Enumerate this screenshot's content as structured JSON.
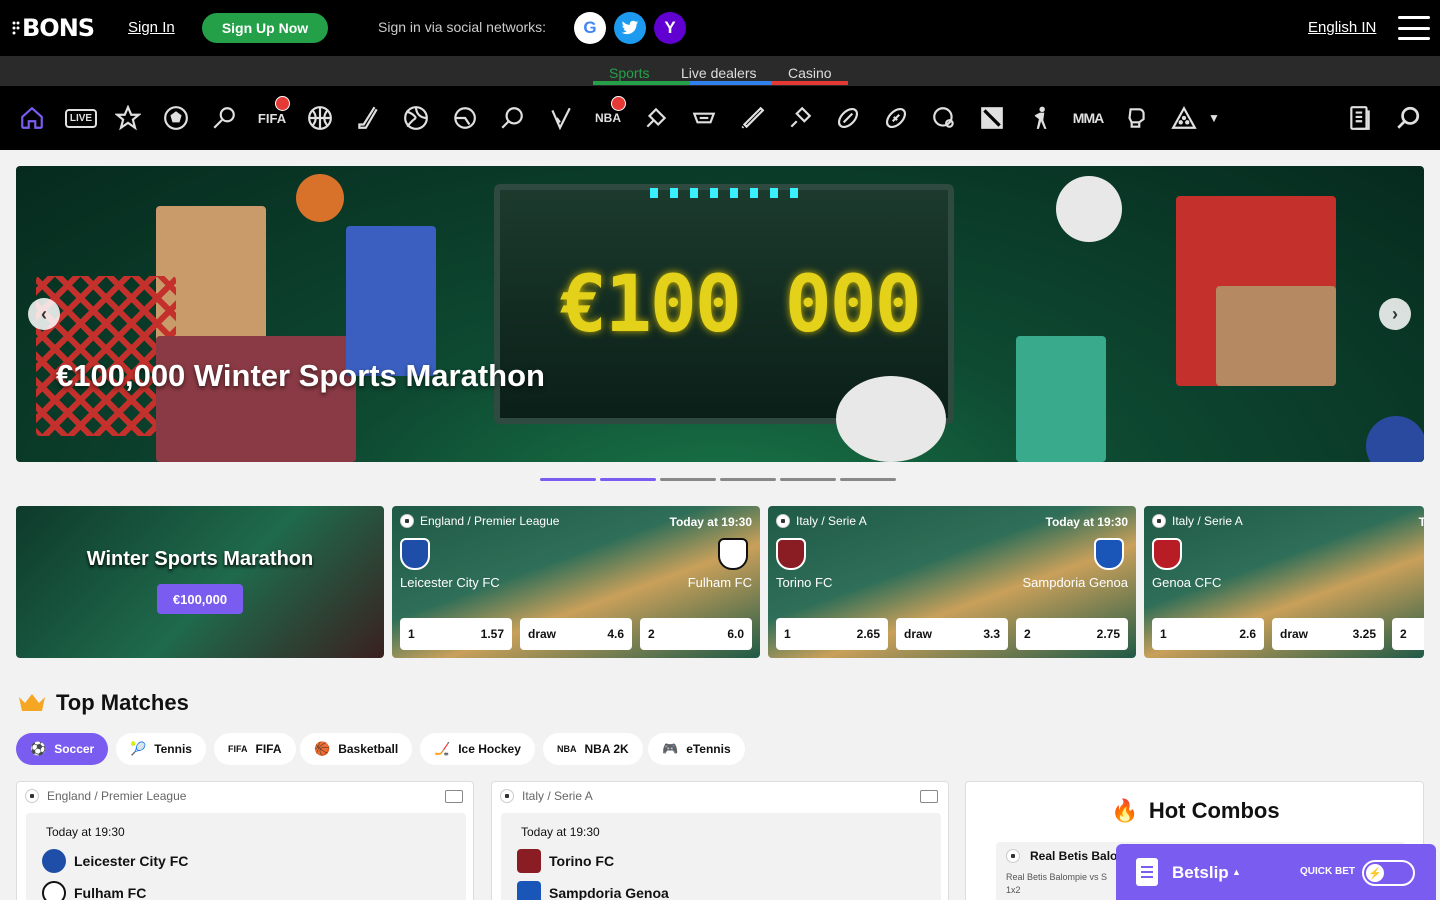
{
  "header": {
    "logo": "BONS",
    "sign_in": "Sign In",
    "sign_up": "Sign Up Now",
    "social_label": "Sign in via social networks:",
    "social": [
      {
        "name": "google",
        "glyph": "G"
      },
      {
        "name": "twitter",
        "glyph": "t"
      },
      {
        "name": "yahoo",
        "glyph": "Y"
      }
    ],
    "language": "English IN"
  },
  "section_tabs": [
    {
      "label": "Sports",
      "color": "#24a148",
      "active": true
    },
    {
      "label": "Live dealers",
      "color": "#2f80ed",
      "active": false
    },
    {
      "label": "Casino",
      "color": "#e53935",
      "active": false
    }
  ],
  "sports_icons": {
    "live_label": "LIVE",
    "fifa_label": "FIFA",
    "mma_label": "MMA",
    "nba_label": "NBA"
  },
  "hero": {
    "title": "€100,000 Winter Sports Marathon",
    "screen_text": "€100 000",
    "slides": 6,
    "active_slide": 2
  },
  "promo": {
    "title": "Winter Sports Marathon",
    "pill": "€100,000"
  },
  "match_cards": [
    {
      "league": "England / Premier League",
      "time": "Today at 19:30",
      "team1": "Leicester City FC",
      "team2": "Fulham FC",
      "odds": [
        {
          "label": "1",
          "value": "1.57"
        },
        {
          "label": "draw",
          "value": "4.6"
        },
        {
          "label": "2",
          "value": "6.0"
        }
      ]
    },
    {
      "league": "Italy / Serie A",
      "time": "Today at 19:30",
      "team1": "Torino FC",
      "team2": "Sampdoria Genoa",
      "odds": [
        {
          "label": "1",
          "value": "2.65"
        },
        {
          "label": "draw",
          "value": "3.3"
        },
        {
          "label": "2",
          "value": "2.75"
        }
      ]
    },
    {
      "league": "Italy / Serie A",
      "time": "T",
      "team1": "Genoa CFC",
      "team2": "",
      "odds": [
        {
          "label": "1",
          "value": "2.6"
        },
        {
          "label": "draw",
          "value": "3.25"
        },
        {
          "label": "2",
          "value": ""
        }
      ]
    }
  ],
  "top_matches": {
    "title": "Top Matches",
    "filters": [
      "Soccer",
      "Tennis",
      "FIFA",
      "Basketball",
      "Ice Hockey",
      "NBA 2K",
      "eTennis"
    ],
    "cards": [
      {
        "league": "England / Premier League",
        "time": "Today at 19:30",
        "team1": "Leicester City FC",
        "team2": "Fulham FC"
      },
      {
        "league": "Italy / Serie A",
        "time": "Today at 19:30",
        "team1": "Torino FC",
        "team2": "Sampdoria Genoa"
      }
    ]
  },
  "hot_combos": {
    "title": "Hot Combos",
    "team": "Real Betis Balo",
    "match": "Real Betis Balompie vs S",
    "market": "1x2"
  },
  "betslip": {
    "label": "Betslip",
    "quick_bet": "QUICK BET"
  },
  "colors": {
    "accent": "#7b5cf0",
    "green": "#24a148",
    "dark": "#000000"
  }
}
